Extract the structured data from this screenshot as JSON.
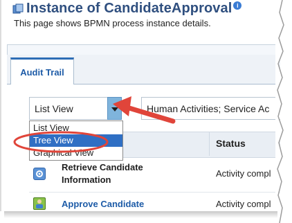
{
  "page": {
    "title": "Instance of CandidateApproval",
    "subtitle": "This page shows BPMN process instance details."
  },
  "tabs": [
    {
      "label": "Audit Trail",
      "active": true
    }
  ],
  "view_select": {
    "selected": "List View",
    "options": [
      "List View",
      "Tree View",
      "Graphical View"
    ],
    "highlighted": "Tree View"
  },
  "filter": {
    "value": "Human Activities; Service Ac"
  },
  "table": {
    "columns": [
      "Status"
    ],
    "rows": [
      {
        "name_line1": "Retrieve Candidate",
        "name_line2": "Information",
        "status": "Activity compl",
        "icon": "service-task-icon"
      },
      {
        "name_line1": "Approve Candidate",
        "name_line2": "",
        "status": "Activity compl",
        "icon": "human-task-icon"
      }
    ]
  },
  "annotations": {
    "highlight_color": "#e0453a",
    "accent": "#2f6fc4"
  }
}
